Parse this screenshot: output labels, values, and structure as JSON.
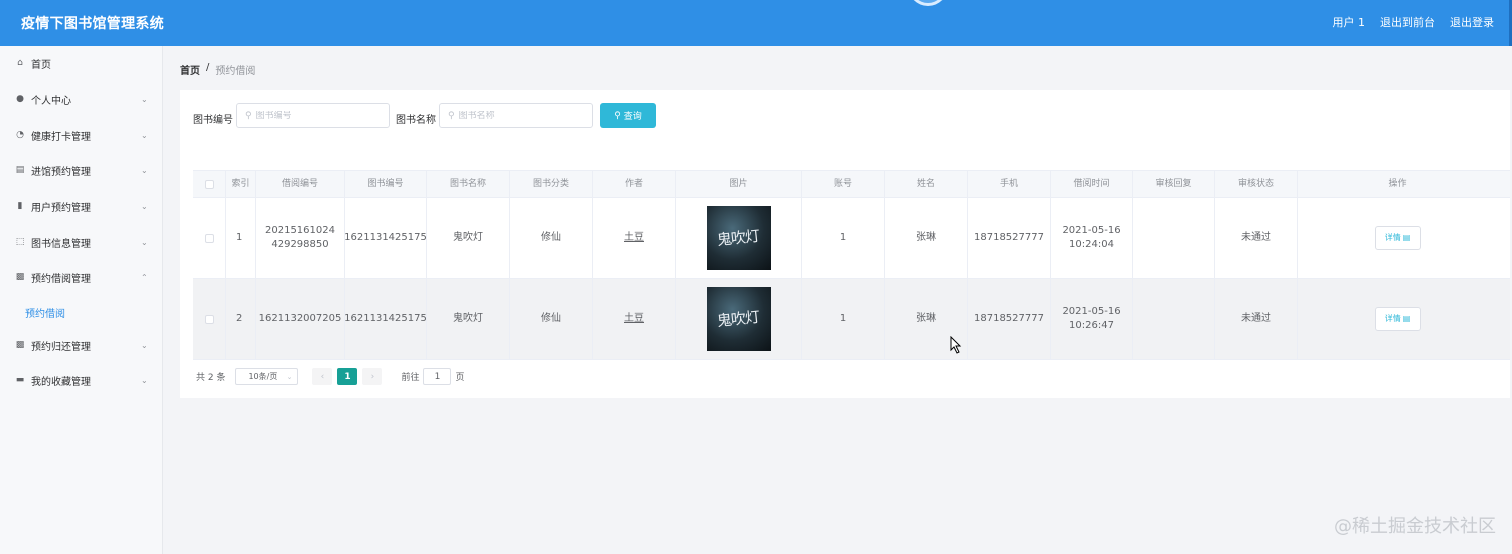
{
  "header": {
    "title": "疫情下图书馆管理系统",
    "links": [
      "用户 1",
      "退出到前台",
      "退出登录"
    ]
  },
  "sidebar": {
    "items": [
      {
        "label": "首页",
        "icon": "home-icon",
        "chevron": false
      },
      {
        "label": "个人中心",
        "icon": "user-icon",
        "chevron": true
      },
      {
        "label": "健康打卡管理",
        "icon": "dashboard-icon",
        "chevron": true
      },
      {
        "label": "进馆预约管理",
        "icon": "building-icon",
        "chevron": true
      },
      {
        "label": "用户预约管理",
        "icon": "bar-chart-icon",
        "chevron": true
      },
      {
        "label": "图书信息管理",
        "icon": "scan-icon",
        "chevron": true
      },
      {
        "label": "预约借阅管理",
        "icon": "clipboard-icon",
        "chevron": true,
        "expanded": true
      },
      {
        "label": "预约归还管理",
        "icon": "clipboard-icon",
        "chevron": true
      },
      {
        "label": "我的收藏管理",
        "icon": "monitor-icon",
        "chevron": true
      }
    ],
    "sub_item": "预约借阅"
  },
  "breadcrumb": {
    "home": "首页",
    "sep": "/",
    "current": "预约借阅"
  },
  "search": {
    "book_no_label": "图书编号",
    "book_no_placeholder": "图书编号",
    "book_name_label": "图书名称",
    "book_name_placeholder": "图书名称",
    "query_label": "查询"
  },
  "table": {
    "headers": [
      "",
      "索引",
      "借阅编号",
      "图书编号",
      "图书名称",
      "图书分类",
      "作者",
      "图片",
      "账号",
      "姓名",
      "手机",
      "借阅时间",
      "审核回复",
      "审核状态",
      "操作"
    ],
    "rows": [
      {
        "index": "1",
        "borrow_no": "20215161024429298850",
        "book_no": "1621131425175",
        "book_name": "鬼吹灯",
        "category": "修仙",
        "author": "土豆",
        "account": "1",
        "name": "张琳",
        "phone": "18718527777",
        "borrow_time": "2021-05-16 10:24:04",
        "reply": "",
        "status": "未通过",
        "action": "详情"
      },
      {
        "index": "2",
        "borrow_no": "1621132007205",
        "book_no": "1621131425175",
        "book_name": "鬼吹灯",
        "category": "修仙",
        "author": "土豆",
        "account": "1",
        "name": "张琳",
        "phone": "18718527777",
        "borrow_time": "2021-05-16 10:26:47",
        "reply": "",
        "status": "未通过",
        "action": "详情"
      }
    ],
    "thumb_text": "鬼吹灯"
  },
  "pagination": {
    "total": "共 2 条",
    "page_size": "10条/页",
    "current_page": "1",
    "goto_label": "前往",
    "goto_value": "1",
    "page_suffix": "页"
  },
  "watermark": "@稀土掘金技术社区"
}
